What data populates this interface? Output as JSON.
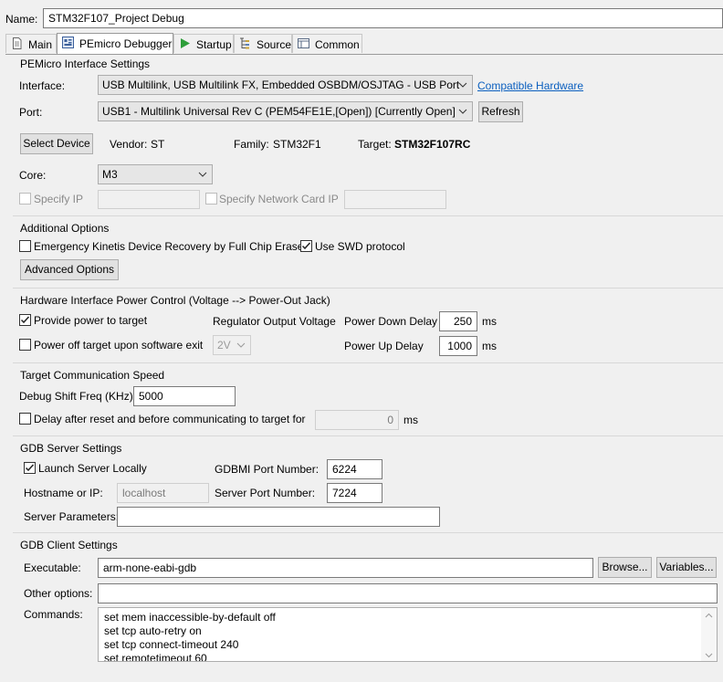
{
  "name": {
    "label": "Name:",
    "value": "STM32F107_Project Debug"
  },
  "tabs": [
    {
      "label": "Main"
    },
    {
      "label": "PEmicro Debugger"
    },
    {
      "label": "Startup"
    },
    {
      "label": "Source"
    },
    {
      "label": "Common"
    }
  ],
  "pemicro": {
    "title": "PEMicro Interface Settings",
    "interface_label": "Interface:",
    "interface_value": "USB Multilink, USB Multilink FX, Embedded OSBDM/OSJTAG - USB Port",
    "compatible_link": "Compatible Hardware",
    "port_label": "Port:",
    "port_value": "USB1 - Multilink Universal Rev C (PEM54FE1E,[Open]) [Currently Open]",
    "refresh_button": "Refresh",
    "select_device_button": "Select Device",
    "vendor_label": "Vendor:",
    "vendor_value": "ST",
    "family_label": "Family:",
    "family_value": "STM32F1",
    "target_label": "Target:",
    "target_value": "STM32F107RC",
    "core_label": "Core:",
    "core_value": "M3",
    "specify_ip_label": "Specify IP",
    "specify_network_label": "Specify Network Card IP"
  },
  "additional": {
    "title": "Additional Options",
    "emergency_label": "Emergency Kinetis Device Recovery by Full Chip Erase",
    "swd_label": "Use SWD protocol",
    "advanced_button": "Advanced Options"
  },
  "power": {
    "title": "Hardware Interface Power Control (Voltage --> Power-Out Jack)",
    "provide_label": "Provide power to target",
    "regulator_label": "Regulator Output Voltage",
    "power_down_label": "Power Down Delay",
    "power_down_value": "250",
    "power_down_unit": "ms",
    "power_off_label": "Power off target upon software exit",
    "voltage_value": "2V",
    "power_up_label": "Power Up Delay",
    "power_up_value": "1000",
    "power_up_unit": "ms"
  },
  "speed": {
    "title": "Target Communication Speed",
    "freq_label": "Debug Shift Freq (KHz)",
    "freq_value": "5000",
    "delay_label": "Delay after reset and before communicating to target for",
    "delay_value": "0",
    "delay_unit": "ms"
  },
  "gdb_server": {
    "title": "GDB Server Settings",
    "launch_label": "Launch Server Locally",
    "gdbmi_label": "GDBMI Port Number:",
    "gdbmi_value": "6224",
    "hostname_label": "Hostname or IP:",
    "hostname_value": "localhost",
    "server_port_label": "Server Port Number:",
    "server_port_value": "7224",
    "params_label": "Server Parameters:",
    "params_value": ""
  },
  "gdb_client": {
    "title": "GDB Client Settings",
    "exec_label": "Executable:",
    "exec_value": "arm-none-eabi-gdb",
    "browse_button": "Browse...",
    "variables_button": "Variables...",
    "other_label": "Other options:",
    "other_value": "",
    "commands_label": "Commands:",
    "commands": [
      "set mem inaccessible-by-default off",
      "set tcp auto-retry on",
      "set tcp connect-timeout 240",
      "set remotetimeout 60"
    ]
  },
  "colors": {
    "link": "#0b5fbf",
    "startup_icon": "#2e9e3a",
    "checkmark": "#222222"
  }
}
